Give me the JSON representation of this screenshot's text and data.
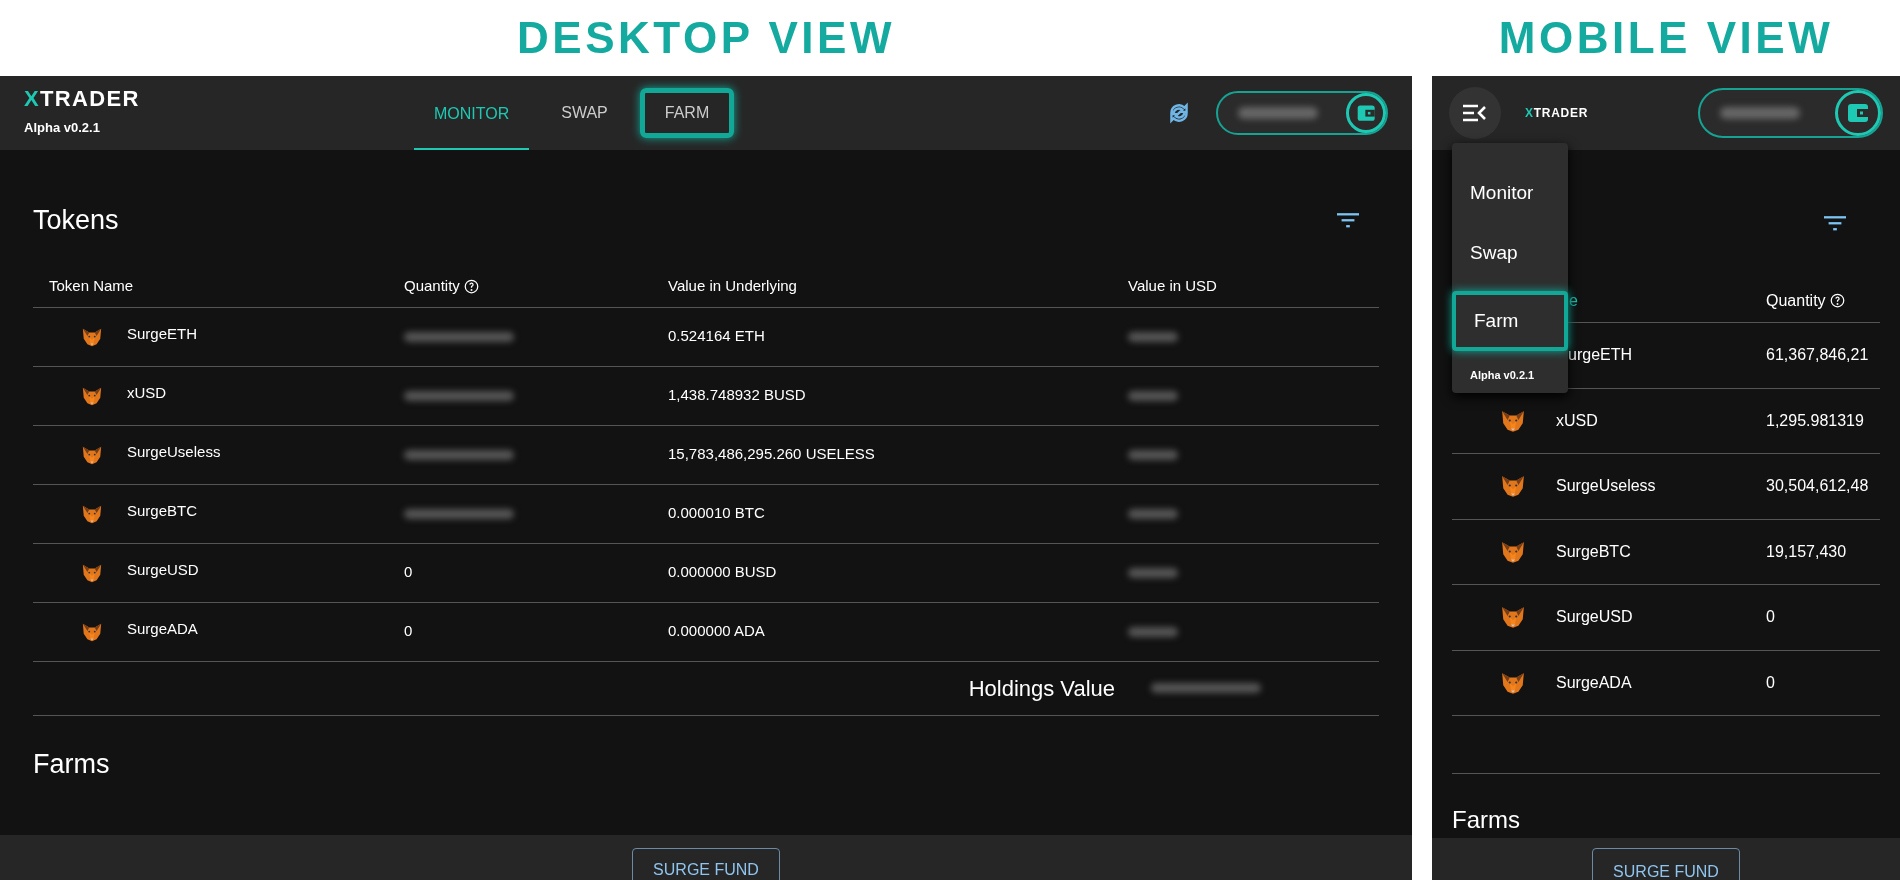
{
  "titles": [
    "DESKTOP VIEW",
    "MOBILE VIEW"
  ],
  "desktop": {
    "logo": {
      "accent": "X",
      "rest": "TRADER"
    },
    "version": "Alpha v0.2.1",
    "nav": [
      {
        "label": "MONITOR",
        "selected": true,
        "highlighted": false
      },
      {
        "label": "SWAP",
        "selected": false,
        "highlighted": false
      },
      {
        "label": "FARM",
        "selected": false,
        "highlighted": true
      }
    ],
    "section_title": "Tokens",
    "columns": [
      {
        "label": "Token Name",
        "help": false
      },
      {
        "label": "Quantity",
        "help": true
      },
      {
        "label": "Value in Underlying",
        "help": false
      },
      {
        "label": "Value in USD",
        "help": false
      }
    ],
    "rows": [
      {
        "name": "SurgeETH",
        "quantity": null,
        "underlying": "0.524164 ETH"
      },
      {
        "name": "xUSD",
        "quantity": null,
        "underlying": "1,438.748932 BUSD"
      },
      {
        "name": "SurgeUseless",
        "quantity": null,
        "underlying": "15,783,486,295.260 USELESS"
      },
      {
        "name": "SurgeBTC",
        "quantity": null,
        "underlying": "0.000010 BTC"
      },
      {
        "name": "SurgeUSD",
        "quantity": "0",
        "underlying": "0.000000 BUSD"
      },
      {
        "name": "SurgeADA",
        "quantity": "0",
        "underlying": "0.000000 ADA"
      }
    ],
    "holdings_label": "Holdings Value",
    "farms_title": "Farms",
    "footer_button": "SURGE FUND"
  },
  "mobile": {
    "logo": {
      "accent": "X",
      "rest": "TRADER"
    },
    "menu": [
      {
        "label": "Monitor",
        "highlighted": false
      },
      {
        "label": "Swap",
        "highlighted": false
      },
      {
        "label": "Farm",
        "highlighted": true
      }
    ],
    "menu_version": "Alpha v0.2.1",
    "columns": [
      {
        "label": "e",
        "help": false
      },
      {
        "label": "Quantity",
        "help": true
      }
    ],
    "rows": [
      {
        "name": "urgeETH",
        "quantity": "61,367,846,21",
        "covered": true
      },
      {
        "name": "xUSD",
        "quantity": "1,295.981319",
        "covered": false
      },
      {
        "name": "SurgeUseless",
        "quantity": "30,504,612,48",
        "covered": false
      },
      {
        "name": "SurgeBTC",
        "quantity": "19,157,430",
        "covered": false
      },
      {
        "name": "SurgeUSD",
        "quantity": "0",
        "covered": false
      },
      {
        "name": "SurgeADA",
        "quantity": "0",
        "covered": false
      }
    ],
    "farms_title": "Farms",
    "footer_button": "SURGE FUND"
  }
}
